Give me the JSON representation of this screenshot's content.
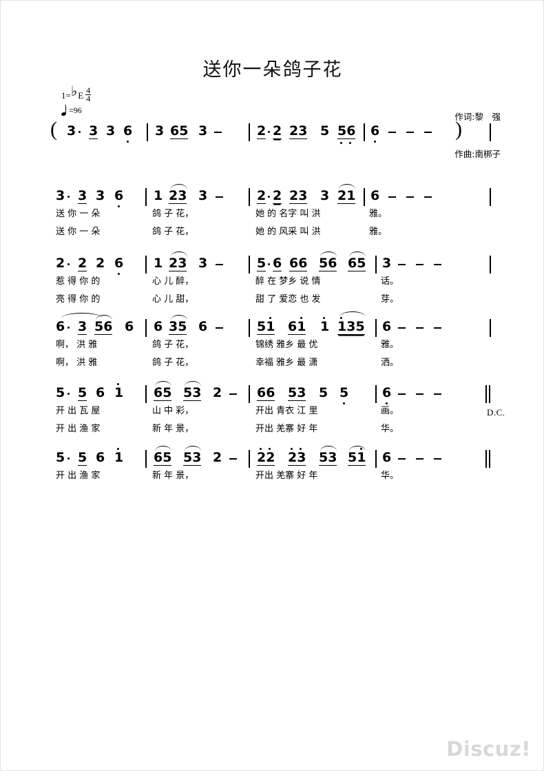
{
  "document": {
    "title": "送你一朵鸽子花",
    "watermark": "Discuz!"
  },
  "header": {
    "key_prefix": "1=",
    "key_accidental": "♭",
    "key_letter": "E",
    "meter_numerator": "4",
    "meter_denominator": "4",
    "tempo_note": "quarter-note",
    "tempo_equals": "=96",
    "lyricist": "作词:黎　强",
    "composer": "作曲:南梆子"
  },
  "score": {
    "intro": {
      "label": "intro-line",
      "open_paren": "(",
      "close_paren": ")",
      "measures": [
        {
          "notes": "3· 3 3 6̣"
        },
        {
          "notes": "3 65 3 −"
        },
        {
          "notes": "2·2 23 5 56"
        },
        {
          "notes": "6̣ − − −"
        }
      ]
    },
    "lines": [
      {
        "label": "line-1",
        "measures": [
          {
            "notes": "3· 3 3 6̣"
          },
          {
            "notes": "1 23 3 −"
          },
          {
            "notes": "2·2 23 3 21"
          },
          {
            "notes": "6 − − −"
          }
        ],
        "lyrics_verse1": [
          "送 你 一 朵",
          "鸽 子 花，",
          "她 的 名字 叫 洪",
          "雅。"
        ],
        "lyrics_verse2": [
          "送 你 一 朵",
          "鸽 子 花，",
          "她 的 风采 叫 洪",
          "雅。"
        ]
      },
      {
        "label": "line-2",
        "measures": [
          {
            "notes": "2· 2 2 6̣"
          },
          {
            "notes": "1 23 3 −"
          },
          {
            "notes": "5·6 66 56 65"
          },
          {
            "notes": "3 − − −"
          }
        ],
        "lyrics_verse1": [
          "惹 得 你 的",
          "心 儿 醉，",
          "醉 在 梦乡 说 情",
          "话。"
        ],
        "lyrics_verse2": [
          "亮 得 你 的",
          "心 儿 甜，",
          "甜 了 爱恋 也 发",
          "芽。"
        ]
      },
      {
        "label": "line-3",
        "measures": [
          {
            "notes": "6· 3 56 6"
          },
          {
            "notes": "6 35 6 −"
          },
          {
            "notes": "51̇ 61̇ 1̇ 1̇35"
          },
          {
            "notes": "6 − − −"
          }
        ],
        "lyrics_verse1": [
          "啊， 洪 雅",
          "鸽 子 花，",
          "锦绣 雅乡 最 优",
          "雅。"
        ],
        "lyrics_verse2": [
          "啊， 洪 雅",
          "鸽 子 花，",
          "幸福 雅乡 最 潇",
          "洒。"
        ]
      },
      {
        "label": "line-4",
        "measures": [
          {
            "notes": "5· 5 6 1̇"
          },
          {
            "notes": "65 53 2 −"
          },
          {
            "notes": "66 53 5 5̣"
          },
          {
            "notes": "6̣ − − −"
          }
        ],
        "lyrics_verse1": [
          "开 出 瓦 屋",
          "山 中 彩，",
          "开出 青衣 江 里",
          "画。"
        ],
        "lyrics_verse2": [
          "开 出 渔 家",
          "新 年 景，",
          "开出 羌寨 好 年",
          "华。"
        ],
        "end_marking": "D.C."
      },
      {
        "label": "line-5",
        "measures": [
          {
            "notes": "5· 5 6 1̇"
          },
          {
            "notes": "65 53 2 −"
          },
          {
            "notes": "2̇2̇ 2̇3̇ 53 51̇"
          },
          {
            "notes": "6 − − −"
          }
        ],
        "lyrics_verse1": [
          "开 出 渔 家",
          "新 年 景，",
          "开出 羌寨 好 年",
          "华。"
        ],
        "lyrics_verse2": null
      }
    ]
  }
}
